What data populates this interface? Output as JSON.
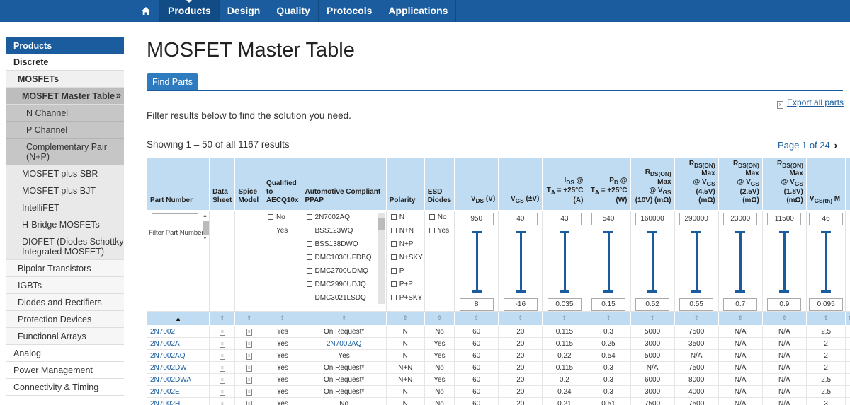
{
  "nav": {
    "items": [
      "Products",
      "Design",
      "Quality",
      "Protocols",
      "Applications"
    ]
  },
  "sidebar": {
    "items": [
      {
        "label": "Products",
        "lvl": "head"
      },
      {
        "label": "Discrete",
        "lvl": "l1"
      },
      {
        "label": "MOSFETs",
        "lvl": "l2"
      },
      {
        "label": "MOSFET Master Table",
        "lvl": "l3a"
      },
      {
        "label": "N Channel",
        "lvl": "l4"
      },
      {
        "label": "P Channel",
        "lvl": "l4"
      },
      {
        "label": "Complementary Pair (N+P)",
        "lvl": "l4 two"
      },
      {
        "label": "MOSFET plus SBR",
        "lvl": "l3"
      },
      {
        "label": "MOSFET plus BJT",
        "lvl": "l3"
      },
      {
        "label": "IntelliFET",
        "lvl": "l3"
      },
      {
        "label": "H-Bridge MOSFETs",
        "lvl": "l3"
      },
      {
        "label": "DIOFET (Diodes Schottky Integrated MOSFET)",
        "lvl": "l3 two"
      },
      {
        "label": "Bipolar Transistors",
        "lvl": "l2b"
      },
      {
        "label": "IGBTs",
        "lvl": "l2b"
      },
      {
        "label": "Diodes and Rectifiers",
        "lvl": "l2b"
      },
      {
        "label": "Protection Devices",
        "lvl": "l2b"
      },
      {
        "label": "Functional Arrays",
        "lvl": "l2b"
      },
      {
        "label": "Analog",
        "lvl": "l1n"
      },
      {
        "label": "Power Management",
        "lvl": "l1n"
      },
      {
        "label": "Connectivity & Timing",
        "lvl": "l1n"
      }
    ]
  },
  "page": {
    "title": "MOSFET Master Table",
    "tab": "Find Parts",
    "export": "Export all parts",
    "filter_text": "Filter results below to find the solution you need.",
    "showing": "Showing 1 – 50 of all 1167 results",
    "pager": "Page 1 of 24",
    "pager_next": "›"
  },
  "filters": {
    "part_placeholder": "Filter Part Numbers",
    "aecq": [
      "No",
      "Yes"
    ],
    "ppap": [
      "2N7002AQ",
      "BSS123WQ",
      "BSS138DWQ",
      "DMC1030UFDBQ",
      "DMC2700UDMQ",
      "DMC2990UDJQ",
      "DMC3021LSDQ"
    ],
    "polarity": [
      "N",
      "N+N",
      "N+P",
      "N+SKY",
      "P",
      "P+P",
      "P+SKY"
    ],
    "esd": [
      "No",
      "Yes"
    ],
    "ranges": [
      [
        "950",
        "8"
      ],
      [
        "40",
        "-16"
      ],
      [
        "43",
        "0.035"
      ],
      [
        "540",
        "0.15"
      ],
      [
        "160000",
        "0.52"
      ],
      [
        "290000",
        "0.55"
      ],
      [
        "23000",
        "0.7"
      ],
      [
        "11500",
        "0.9"
      ],
      [
        "46",
        "0.095"
      ]
    ]
  },
  "table": {
    "headers": {
      "part": "Part Number",
      "ds": "Data Sheet",
      "spice": "Spice Model",
      "aecq": "Qualified to AECQ10x",
      "ppap": "Automotive Compliant PPAP",
      "pol": "Polarity",
      "esd": "ESD Diodes"
    },
    "rows": [
      [
        "2N7002",
        "Yes",
        "On Request*",
        "N",
        "No",
        "60",
        "20",
        "0.115",
        "0.3",
        "5000",
        "7500",
        "N/A",
        "N/A",
        "2.5"
      ],
      [
        "2N7002A",
        "Yes",
        "2N7002AQ",
        "N",
        "Yes",
        "60",
        "20",
        "0.115",
        "0.25",
        "3000",
        "3500",
        "N/A",
        "N/A",
        "2"
      ],
      [
        "2N7002AQ",
        "Yes",
        "Yes",
        "N",
        "Yes",
        "60",
        "20",
        "0.22",
        "0.54",
        "5000",
        "N/A",
        "N/A",
        "N/A",
        "2"
      ],
      [
        "2N7002DW",
        "Yes",
        "On Request*",
        "N+N",
        "No",
        "60",
        "20",
        "0.115",
        "0.3",
        "N/A",
        "7500",
        "N/A",
        "N/A",
        "2"
      ],
      [
        "2N7002DWA",
        "Yes",
        "On Request*",
        "N+N",
        "Yes",
        "60",
        "20",
        "0.2",
        "0.3",
        "6000",
        "8000",
        "N/A",
        "N/A",
        "2.5"
      ],
      [
        "2N7002E",
        "Yes",
        "On Request*",
        "N",
        "No",
        "60",
        "20",
        "0.24",
        "0.3",
        "3000",
        "4000",
        "N/A",
        "N/A",
        "2.5"
      ],
      [
        "2N7002H",
        "Yes",
        "No",
        "N",
        "No",
        "60",
        "20",
        "0.21",
        "0.51",
        "7500",
        "7500",
        "N/A",
        "N/A",
        "3"
      ]
    ]
  }
}
